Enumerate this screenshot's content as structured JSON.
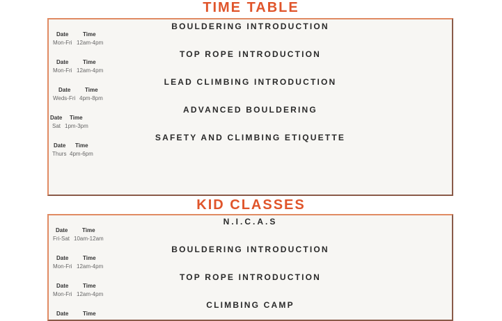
{
  "timetable": {
    "heading": "TIME TABLE",
    "date_header": "Date",
    "time_header": "Time",
    "courses": [
      {
        "title": "BOULDERING INTRODUCTION",
        "date": "Mon-Fri",
        "time": "12am-4pm"
      },
      {
        "title": "TOP ROPE INTRODUCTION",
        "date": "Mon-Fri",
        "time": "12am-4pm"
      },
      {
        "title": "LEAD CLIMBING INTRODUCTION",
        "date": "Weds-Fri",
        "time": "4pm-8pm"
      },
      {
        "title": "ADVANCED BOULDERING",
        "date": "Sat",
        "time": "1pm-3pm"
      },
      {
        "title": "SAFETY AND CLIMBING ETIQUETTE",
        "date": "Thurs",
        "time": "4pm-6pm"
      }
    ]
  },
  "kids": {
    "heading": "KID CLASSES",
    "date_header": "Date",
    "time_header": "Time",
    "courses": [
      {
        "title": "N.I.C.A.S",
        "date": "Fri-Sat",
        "time": "10am-12am"
      },
      {
        "title": "BOULDERING INTRODUCTION",
        "date": "Mon-Fri",
        "time": "12am-4pm"
      },
      {
        "title": "TOP ROPE INTRODUCTION",
        "date": "Mon-Fri",
        "time": "12am-4pm"
      },
      {
        "title": "CLIMBING CAMP",
        "date": "",
        "time": ""
      }
    ]
  }
}
